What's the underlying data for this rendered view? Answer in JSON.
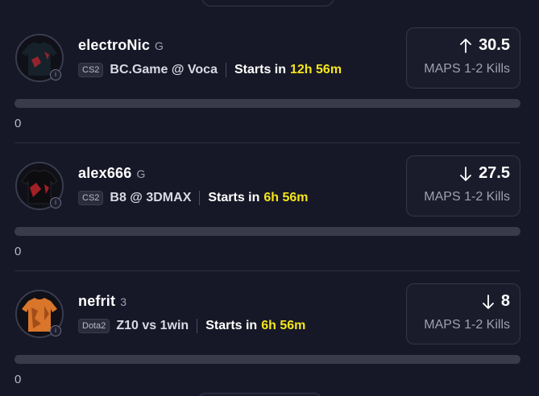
{
  "players": [
    {
      "name": "electroNic",
      "rank": "G",
      "game": "CS2",
      "match": "BC.Game @ Voca",
      "starts_label": "Starts in",
      "starts_time": "12h 56m",
      "direction": "up",
      "line_value": "30.5",
      "line_stat": "MAPS 1-2 Kills",
      "progress": 0,
      "progress_count": "0",
      "jersey_color": "#16212a",
      "jersey_accent": "#b3262e"
    },
    {
      "name": "alex666",
      "rank": "G",
      "game": "CS2",
      "match": "B8 @ 3DMAX",
      "starts_label": "Starts in",
      "starts_time": "6h 56m",
      "direction": "down",
      "line_value": "27.5",
      "line_stat": "MAPS 1-2 Kills",
      "progress": 0,
      "progress_count": "0",
      "jersey_color": "#0d0d10",
      "jersey_accent": "#c0232b"
    },
    {
      "name": "nefrit",
      "rank": "3",
      "game": "Dota2",
      "match": "Z10 vs 1win",
      "starts_label": "Starts in",
      "starts_time": "6h 56m",
      "direction": "down",
      "line_value": "8",
      "line_stat": "MAPS 1-2 Kills",
      "progress": 0,
      "progress_count": "0",
      "jersey_color": "#d9762b",
      "jersey_accent": "#8a3c12"
    }
  ],
  "icons": {
    "info": "info-icon",
    "up": "arrow-up-icon",
    "down": "arrow-down-icon"
  },
  "colors": {
    "background": "#171827",
    "highlight_time": "#f5e51b",
    "muted_text": "#9ea0b0"
  }
}
